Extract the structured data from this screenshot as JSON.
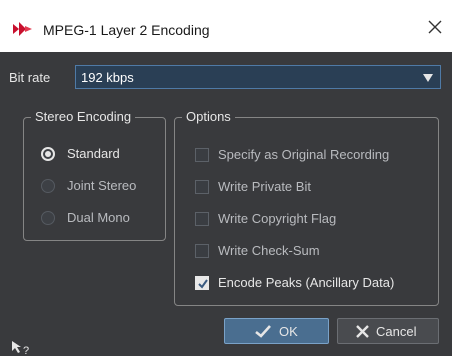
{
  "window": {
    "title": "MPEG-1 Layer 2 Encoding"
  },
  "bit_rate": {
    "label": "Bit rate",
    "value": "192 kbps"
  },
  "stereo_encoding": {
    "legend": "Stereo Encoding",
    "options": [
      {
        "label": "Standard",
        "selected": true
      },
      {
        "label": "Joint Stereo",
        "selected": false
      },
      {
        "label": "Dual Mono",
        "selected": false
      }
    ]
  },
  "options_group": {
    "legend": "Options",
    "items": [
      {
        "label": "Specify as Original Recording",
        "checked": false
      },
      {
        "label": "Write Private Bit",
        "checked": false
      },
      {
        "label": "Write Copyright Flag",
        "checked": false
      },
      {
        "label": "Write Check-Sum",
        "checked": false
      },
      {
        "label": "Encode Peaks (Ancillary Data)",
        "checked": true
      }
    ]
  },
  "buttons": {
    "ok": "OK",
    "cancel": "Cancel"
  },
  "colors": {
    "accent": "#4a6e90",
    "panel": "#393a3d",
    "logo": "#c8102e"
  }
}
